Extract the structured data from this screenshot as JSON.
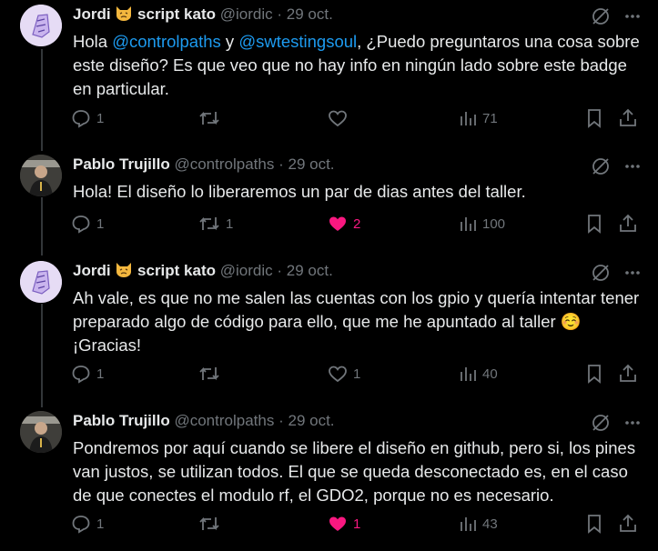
{
  "tweets": [
    {
      "name": "Jordi",
      "name_suffix": "script kato",
      "handle": "@iordic",
      "time": "29 oct.",
      "text_parts": [
        "Hola ",
        "@controlpaths",
        " y ",
        "@swtestingsoul",
        ", ¿Puedo preguntaros una cosa sobre este diseño? Es que veo que no hay info en ningún lado sobre este badge en particular."
      ],
      "replies": "1",
      "retweets": "",
      "likes": "",
      "liked": false,
      "views": "71"
    },
    {
      "name": "Pablo Trujillo",
      "handle": "@controlpaths",
      "time": "29 oct.",
      "text": "Hola! El diseño lo liberaremos un par de dias antes del taller.",
      "replies": "1",
      "retweets": "1",
      "likes": "2",
      "liked": true,
      "views": "100"
    },
    {
      "name": "Jordi",
      "name_suffix": "script kato",
      "handle": "@iordic",
      "time": "29 oct.",
      "text": "Ah vale, es que no me salen las cuentas con los gpio y quería intentar tener preparado algo de código para ello, que me he apuntado al taller ☺️",
      "text2": "¡Gracias!",
      "replies": "1",
      "retweets": "",
      "likes": "1",
      "liked": false,
      "views": "40"
    },
    {
      "name": "Pablo Trujillo",
      "handle": "@controlpaths",
      "time": "29 oct.",
      "text": "Pondremos por aquí cuando se libere el diseño en github, pero si, los pines van justos, se utilizan todos. El que se queda desconectado es, en el caso de que conectes el modulo rf, el GDO2, porque no es necesario.",
      "replies": "1",
      "retweets": "",
      "likes": "1",
      "liked": true,
      "views": "43"
    }
  ],
  "separator": "·",
  "colors": {
    "background": "#000000",
    "text": "#e7e9ea",
    "muted": "#71767b",
    "link": "#1d9bf0",
    "like": "#f91880"
  }
}
